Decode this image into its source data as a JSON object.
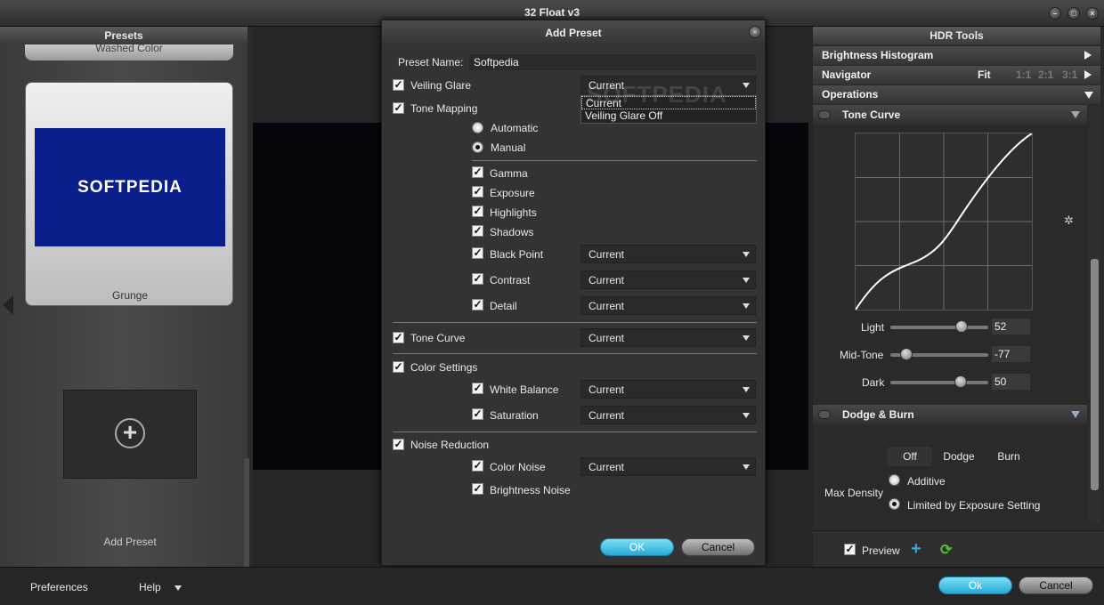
{
  "window": {
    "title": "32 Float v3"
  },
  "presets": {
    "header": "Presets",
    "partial_item": "Washed Color",
    "selected_item": {
      "label": "Grunge",
      "thumb_text": "SOFTPEDIA"
    },
    "add_label": "Add Preset"
  },
  "dialog": {
    "title": "Add Preset",
    "preset_name_label": "Preset Name:",
    "preset_name_value": "Softpedia",
    "watermark": "SOFTPEDIA",
    "veiling_glare": {
      "label": "Veiling Glare",
      "dropdown": "Current",
      "options": [
        "Current",
        "Veiling Glare Off"
      ]
    },
    "tone_mapping": {
      "label": "Tone Mapping",
      "automatic": "Automatic",
      "manual": "Manual",
      "gamma": "Gamma",
      "exposure": "Exposure",
      "highlights": "Highlights",
      "shadows": "Shadows",
      "black_point": {
        "label": "Black Point",
        "value": "Current"
      },
      "contrast": {
        "label": "Contrast",
        "value": "Current"
      },
      "detail": {
        "label": "Detail",
        "value": "Current"
      }
    },
    "tone_curve": {
      "label": "Tone Curve",
      "value": "Current"
    },
    "color_settings": {
      "label": "Color Settings",
      "white_balance": {
        "label": "White Balance",
        "value": "Current"
      },
      "saturation": {
        "label": "Saturation",
        "value": "Current"
      }
    },
    "noise_reduction": {
      "label": "Noise Reduction",
      "color_noise": {
        "label": "Color Noise",
        "value": "Current"
      },
      "brightness_noise": "Brightness Noise"
    },
    "ok": "OK",
    "cancel": "Cancel"
  },
  "hdr": {
    "header": "HDR Tools",
    "brightness_histogram": "Brightness Histogram",
    "navigator": {
      "label": "Navigator",
      "fit": "Fit",
      "z1": "1:1",
      "z2": "2:1",
      "z3": "3:1"
    },
    "operations": "Operations",
    "tone_curve": {
      "label": "Tone Curve",
      "light": {
        "label": "Light",
        "value": "52",
        "position": 0.73
      },
      "midtone": {
        "label": "Mid-Tone",
        "value": "-77",
        "position": 0.16
      },
      "dark": {
        "label": "Dark",
        "value": "50",
        "position": 0.72
      }
    },
    "dodge_burn": {
      "label": "Dodge & Burn",
      "modes": [
        "Off",
        "Dodge",
        "Burn"
      ],
      "max_density": "Max Density",
      "additive": "Additive",
      "limited": "Limited by Exposure Setting"
    },
    "preview": "Preview"
  },
  "footer": {
    "preferences": "Preferences",
    "help": "Help",
    "ok": "Ok",
    "cancel": "Cancel"
  },
  "colors": {
    "accent": "#25a9d6",
    "thumb_bg": "#0a1e8c"
  }
}
